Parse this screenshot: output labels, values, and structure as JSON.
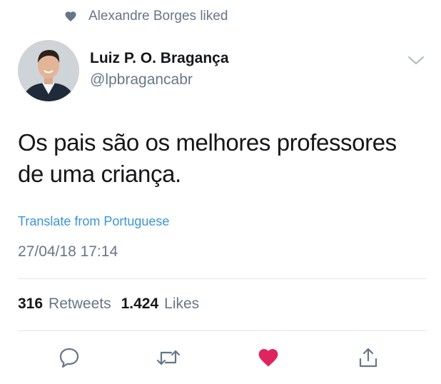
{
  "social_context": {
    "icon": "heart-icon",
    "text": "Alexandre Borges liked"
  },
  "author": {
    "display_name": "Luiz P. O. Bragança",
    "handle": "@lpbragancabr"
  },
  "tweet": {
    "text_line_1": "Os pais são os melhores professores",
    "text_line_2": "de uma criança.",
    "translate_label": "Translate from Portuguese",
    "timestamp": "27/04/18 17:14"
  },
  "stats": {
    "retweets_count": "316",
    "retweets_label": "Retweets",
    "likes_count": "1.424",
    "likes_label": "Likes"
  },
  "actions": [
    {
      "name": "reply",
      "icon": "speech-bubble-icon"
    },
    {
      "name": "retweet",
      "icon": "retweet-arrows-icon"
    },
    {
      "name": "like",
      "icon": "heart-icon",
      "active": true
    },
    {
      "name": "share",
      "icon": "share-upload-icon"
    }
  ],
  "colors": {
    "text_primary": "#14171a",
    "text_secondary": "#657786",
    "link": "#3b94d9",
    "like_active": "#e0245e",
    "divider": "#e1e8ed"
  }
}
